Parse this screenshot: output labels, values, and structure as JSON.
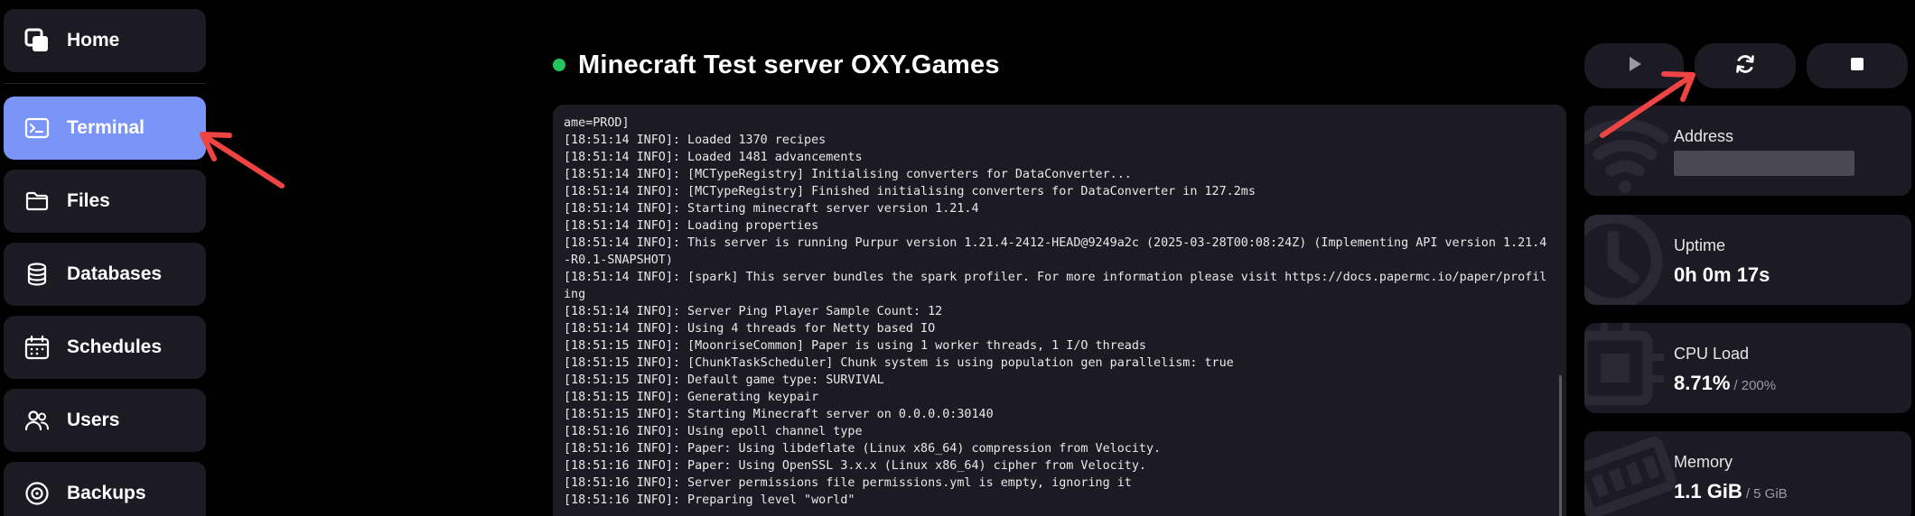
{
  "sidebar": {
    "items": [
      {
        "label": "Home",
        "icon": "home-icon"
      },
      {
        "label": "Terminal",
        "icon": "terminal-icon",
        "active": true
      },
      {
        "label": "Files",
        "icon": "folder-icon"
      },
      {
        "label": "Databases",
        "icon": "database-icon"
      },
      {
        "label": "Schedules",
        "icon": "calendar-icon"
      },
      {
        "label": "Users",
        "icon": "users-icon"
      },
      {
        "label": "Backups",
        "icon": "backup-icon"
      }
    ]
  },
  "header": {
    "title": "Minecraft Test server OXY.Games",
    "status": "online",
    "status_color": "#22c55e"
  },
  "power_buttons": [
    {
      "name": "start",
      "icon": "play-icon"
    },
    {
      "name": "restart",
      "icon": "restart-icon"
    },
    {
      "name": "stop",
      "icon": "stop-icon"
    }
  ],
  "terminal": {
    "lines": [
      "ame=PROD]",
      "[18:51:14 INFO]: Loaded 1370 recipes",
      "[18:51:14 INFO]: Loaded 1481 advancements",
      "[18:51:14 INFO]: [MCTypeRegistry] Initialising converters for DataConverter...",
      "[18:51:14 INFO]: [MCTypeRegistry] Finished initialising converters for DataConverter in 127.2ms",
      "[18:51:14 INFO]: Starting minecraft server version 1.21.4",
      "[18:51:14 INFO]: Loading properties",
      "[18:51:14 INFO]: This server is running Purpur version 1.21.4-2412-HEAD@9249a2c (2025-03-28T00:08:24Z) (Implementing API version 1.21.4-R0.1-SNAPSHOT)",
      "[18:51:14 INFO]: [spark] This server bundles the spark profiler. For more information please visit https://docs.papermc.io/paper/profiling",
      "[18:51:14 INFO]: Server Ping Player Sample Count: 12",
      "[18:51:14 INFO]: Using 4 threads for Netty based IO",
      "[18:51:15 INFO]: [MoonriseCommon] Paper is using 1 worker threads, 1 I/O threads",
      "[18:51:15 INFO]: [ChunkTaskScheduler] Chunk system is using population gen parallelism: true",
      "[18:51:15 INFO]: Default game type: SURVIVAL",
      "[18:51:15 INFO]: Generating keypair",
      "[18:51:15 INFO]: Starting Minecraft server on 0.0.0.0:30140",
      "[18:51:16 INFO]: Using epoll channel type",
      "[18:51:16 INFO]: Paper: Using libdeflate (Linux x86_64) compression from Velocity.",
      "[18:51:16 INFO]: Paper: Using OpenSSL 3.x.x (Linux x86_64) cipher from Velocity.",
      "[18:51:16 INFO]: Server permissions file permissions.yml is empty, ignoring it",
      "[18:51:16 INFO]: Preparing level \"world\""
    ]
  },
  "stats": {
    "address": {
      "label": "Address",
      "icon": "wifi-icon"
    },
    "uptime": {
      "label": "Uptime",
      "value": "0h 0m 17s",
      "icon": "clock-icon"
    },
    "cpu": {
      "label": "CPU Load",
      "value": "8.71%",
      "limit": "/ 200%",
      "icon": "cpu-icon"
    },
    "memory": {
      "label": "Memory",
      "value": "1.1 GiB",
      "limit": "/ 5 GiB",
      "icon": "memory-icon"
    }
  },
  "colors": {
    "accent": "#7a95f7",
    "panel": "#1c1a23",
    "annotation": "#ef4444"
  }
}
